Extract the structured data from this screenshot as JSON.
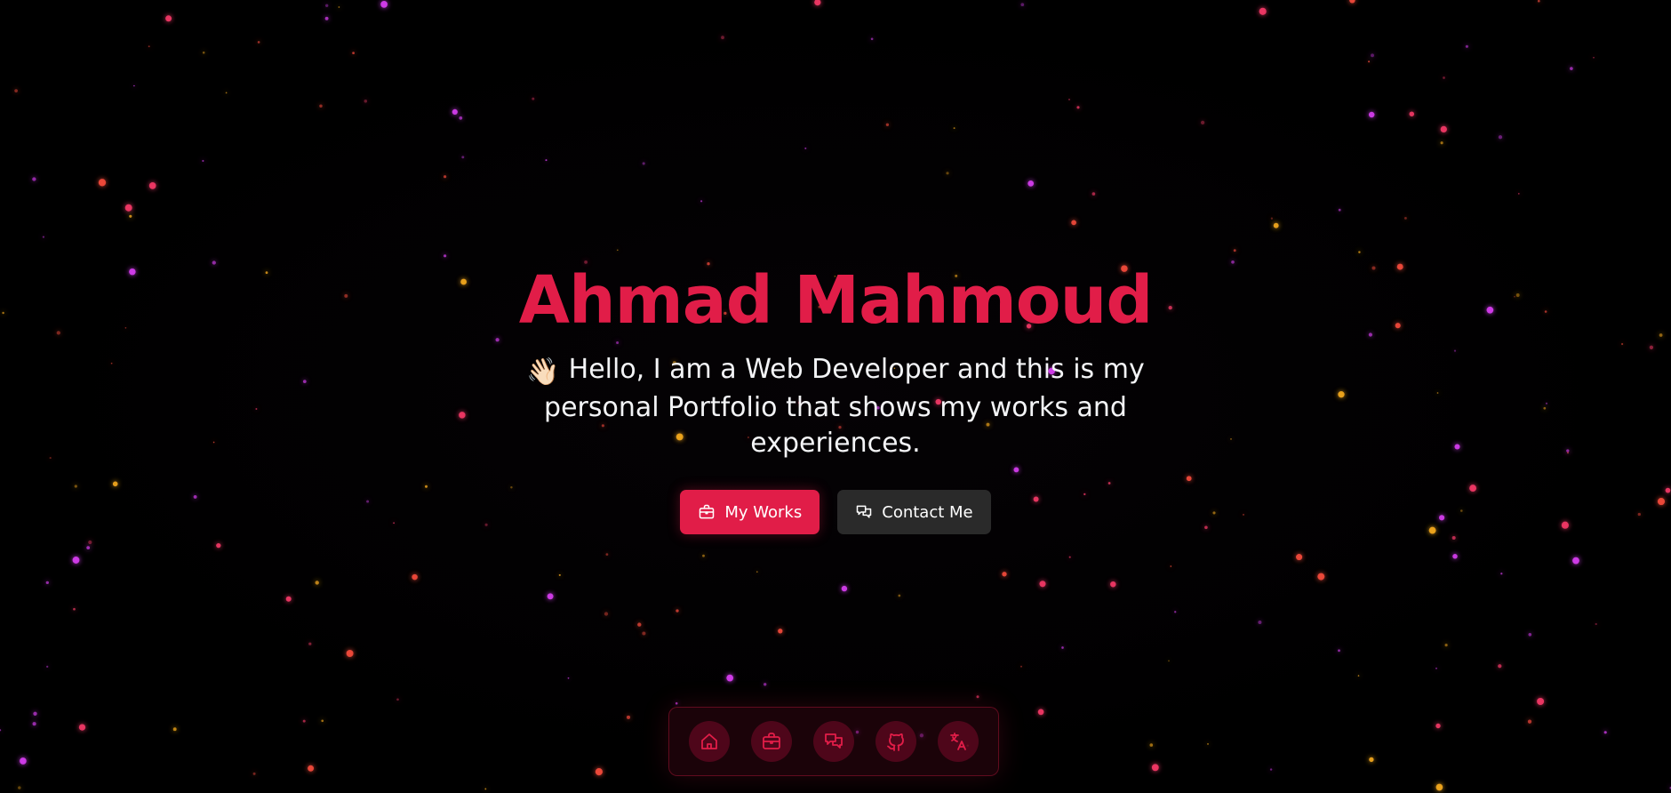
{
  "hero": {
    "title": "Ahmad Mahmoud",
    "wave_emoji": "👋🏻",
    "subtitle": "Hello, I am a Web Developer and this is my personal Portfolio that shows my works and experiences."
  },
  "actions": {
    "primary": {
      "label": "My Works",
      "icon": "briefcase-icon"
    },
    "secondary": {
      "label": "Contact Me",
      "icon": "chat-bubbles-icon"
    }
  },
  "dock": {
    "items": [
      {
        "icon": "home-icon"
      },
      {
        "icon": "briefcase-icon"
      },
      {
        "icon": "chat-bubbles-icon"
      },
      {
        "icon": "github-icon"
      },
      {
        "icon": "translate-icon"
      }
    ]
  },
  "colors": {
    "background": "#000000",
    "accent": "#e11d48",
    "secondary_button": "#2a2a2a",
    "text": "#f3f4f6",
    "particles": [
      "#ff4d3d",
      "#ffb020",
      "#e040fb",
      "#ff3b6b"
    ]
  }
}
